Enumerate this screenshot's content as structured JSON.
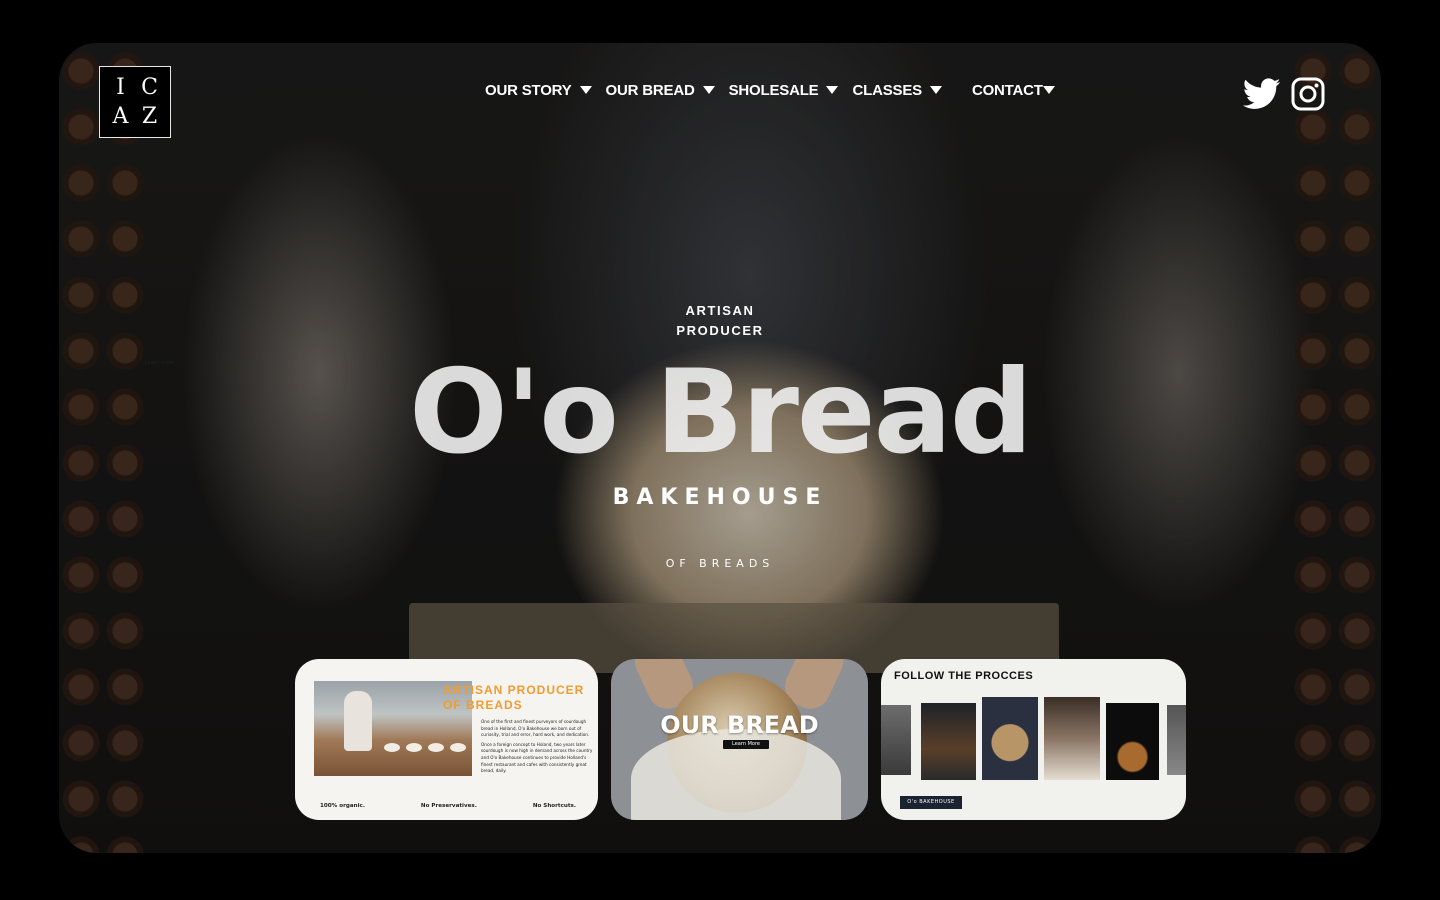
{
  "logo": {
    "letters": [
      "I",
      "C",
      "A",
      "Z"
    ]
  },
  "nav": {
    "items": [
      "OUR STORY",
      "OUR BREAD",
      "SHOLESALE",
      "CLASSES"
    ],
    "contact": "CONTACT"
  },
  "social": {
    "icons": [
      "twitter-icon",
      "instagram-icon"
    ]
  },
  "hero": {
    "tiny_text": "Learn more",
    "eyebrow_line1": "ARTISAN",
    "eyebrow_line2": "PRODUCER",
    "title": "O'o Bread",
    "subtitle": "BAKEHOUSE",
    "tagline": "OF BREADS"
  },
  "cards": {
    "producer": {
      "heading_line1": "ARTISAN PRODUCER",
      "heading_line2": "OF BREADS",
      "para1": "One of the first and finest purveyors of sourdough bread in Holland, O'o Bakehouse we born out of curiosity, trial and error, hard work, and dedication.",
      "para2": "Once a foreign concept to Holand, two years later sourdough is now high in demand across the country and O'o Bakehouse continues to provide Holland's finest restaurant and cafes with consistently great bread, daily.",
      "footer": [
        "100% organic.",
        "No Preservatives.",
        "No Shortcuts."
      ]
    },
    "bread": {
      "title": "OUR BREAD",
      "button": "Learn More"
    },
    "process": {
      "title": "FOLLOW THE PROCCES",
      "button": "O'o BAKEHOUSE"
    }
  },
  "colors": {
    "accent": "#f29b2e",
    "dark_button": "#1b2230"
  }
}
